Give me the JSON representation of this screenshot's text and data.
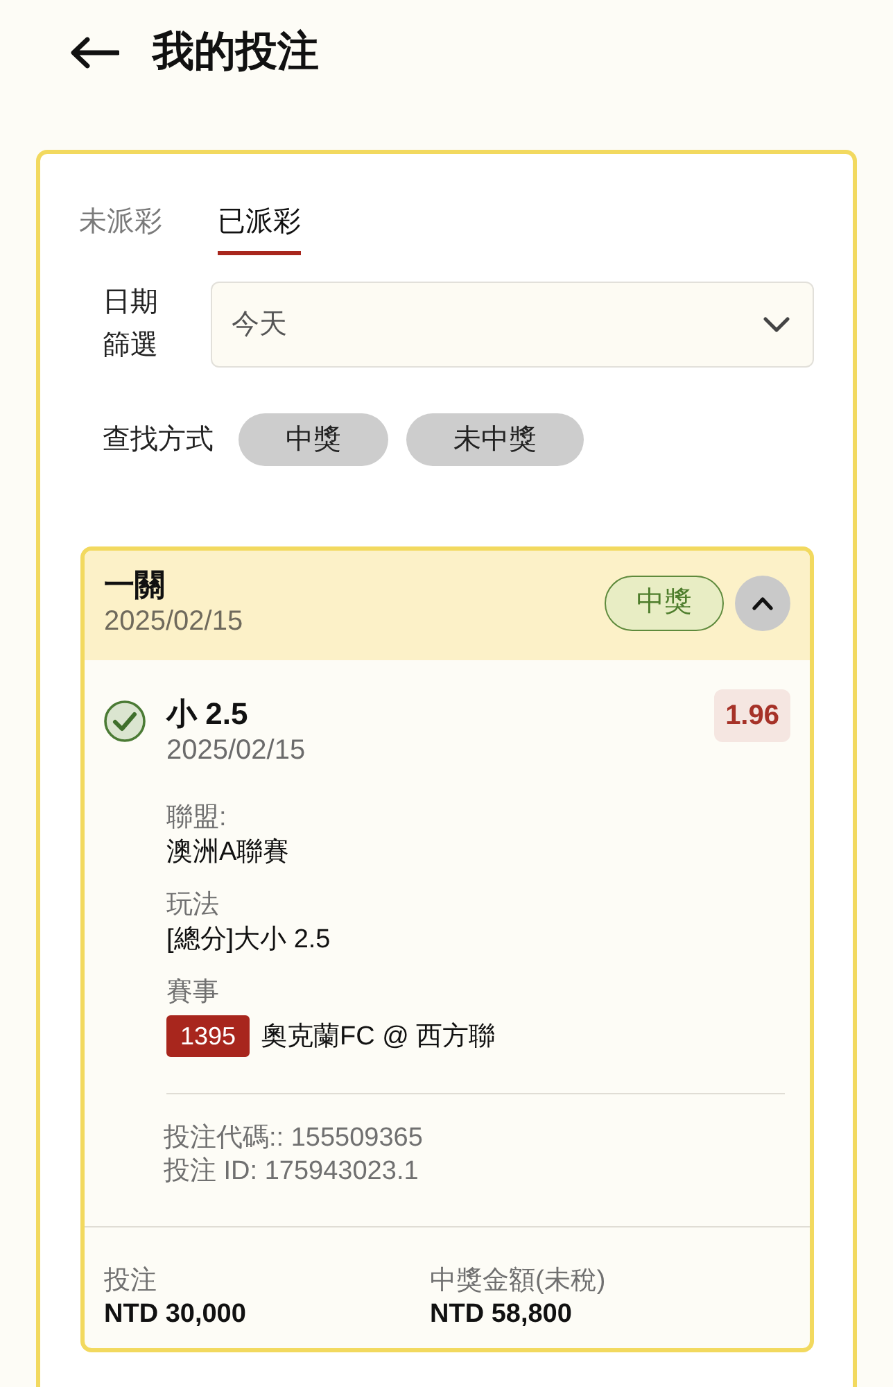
{
  "header": {
    "title": "我的投注"
  },
  "tabs": [
    {
      "label": "未派彩",
      "selected": false
    },
    {
      "label": "已派彩",
      "selected": true
    }
  ],
  "date_filter": {
    "label": "日期篩選",
    "value": "今天"
  },
  "search": {
    "label": "查找方式",
    "options": [
      {
        "label": "中獎",
        "selected": false
      },
      {
        "label": "未中獎",
        "selected": false
      }
    ]
  },
  "bet": {
    "title": "一關",
    "date": "2025/02/15",
    "result": "中獎",
    "won": true,
    "expanded": true,
    "pick": {
      "name": "小 2.5",
      "date": "2025/02/15",
      "won": true,
      "odds": "1.96"
    },
    "details": [
      {
        "kind": "text",
        "label": "聯盟:",
        "value": "澳洲A聯賽"
      },
      {
        "kind": "text",
        "label": "玩法",
        "value": "[總分]大小 2.5"
      },
      {
        "kind": "match",
        "label": "賽事",
        "match_no": "1395",
        "value": "奧克蘭FC @ 西方聯"
      }
    ],
    "codes": [
      "投注代碼:: 155509365",
      "投注 ID: 175943023.1"
    ],
    "stake": {
      "label": "投注",
      "value": "NTD 30,000"
    },
    "payout": {
      "label": "中獎金額(未稅)",
      "value": "NTD 58,800"
    }
  }
}
